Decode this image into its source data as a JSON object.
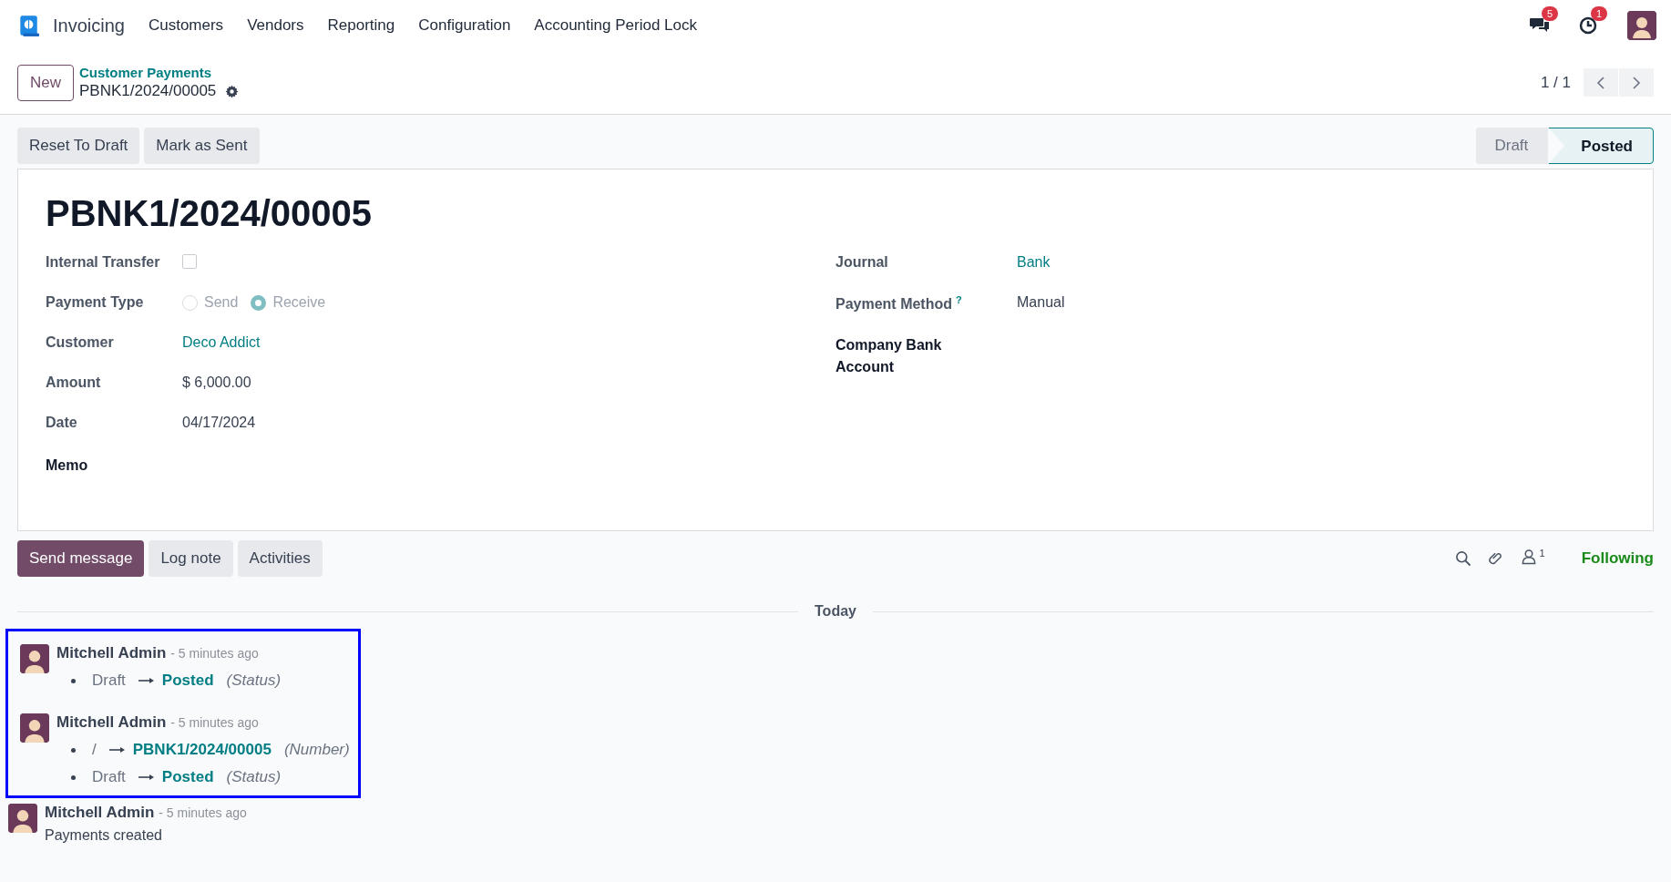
{
  "navbar": {
    "app": "Invoicing",
    "menu": [
      "Customers",
      "Vendors",
      "Reporting",
      "Configuration",
      "Accounting Period Lock"
    ],
    "notifications": [
      {
        "kind": "messages",
        "count": "5"
      },
      {
        "kind": "activities",
        "count": "1"
      }
    ]
  },
  "control_panel": {
    "new_button": "New",
    "breadcrumb": "Customer Payments",
    "record": "PBNK1/2024/00005",
    "pager": "1 / 1"
  },
  "actions": [
    "Reset To Draft",
    "Mark as Sent"
  ],
  "statusbar": [
    {
      "label": "Draft",
      "selected": false
    },
    {
      "label": "Posted",
      "selected": true
    }
  ],
  "form": {
    "title": "PBNK1/2024/00005",
    "left": [
      {
        "kind": "checkbox",
        "label": "Internal Transfer",
        "checked": false
      },
      {
        "kind": "radio",
        "label": "Payment Type",
        "options": [
          {
            "label": "Send",
            "selected": false
          },
          {
            "label": "Receive",
            "selected": true
          }
        ]
      },
      {
        "kind": "link",
        "label": "Customer",
        "value": "Deco Addict"
      },
      {
        "kind": "text",
        "label": "Amount",
        "value": "$ 6,000.00"
      },
      {
        "kind": "text",
        "label": "Date",
        "value": "04/17/2024"
      },
      {
        "kind": "empty",
        "label": "Memo"
      }
    ],
    "right": [
      {
        "kind": "link",
        "label": "Journal",
        "value": "Bank"
      },
      {
        "kind": "text",
        "label": "Payment Method",
        "help": "?",
        "value": "Manual"
      },
      {
        "kind": "empty",
        "label": "Company Bank Account"
      }
    ]
  },
  "chatter": {
    "buttons": [
      {
        "label": "Send message",
        "selected": true
      },
      {
        "label": "Log note",
        "selected": false
      },
      {
        "label": "Activities",
        "selected": false
      }
    ],
    "followers": "1",
    "follow": "Following",
    "date_separator": "Today",
    "messages": [
      {
        "author": "Mitchell Admin",
        "time": "- 5 minutes ago",
        "highlighted": true,
        "changes": [
          {
            "old": "Draft",
            "new": "Posted",
            "field": "(Status)"
          }
        ]
      },
      {
        "author": "Mitchell Admin",
        "time": "- 5 minutes ago",
        "highlighted": true,
        "changes": [
          {
            "old": "/",
            "new": "PBNK1/2024/00005",
            "field": "(Number)"
          },
          {
            "old": "Draft",
            "new": "Posted",
            "field": "(Status)"
          }
        ]
      },
      {
        "author": "Mitchell Admin",
        "time": "- 5 minutes ago",
        "highlighted": false,
        "body": "Payments created"
      }
    ]
  }
}
